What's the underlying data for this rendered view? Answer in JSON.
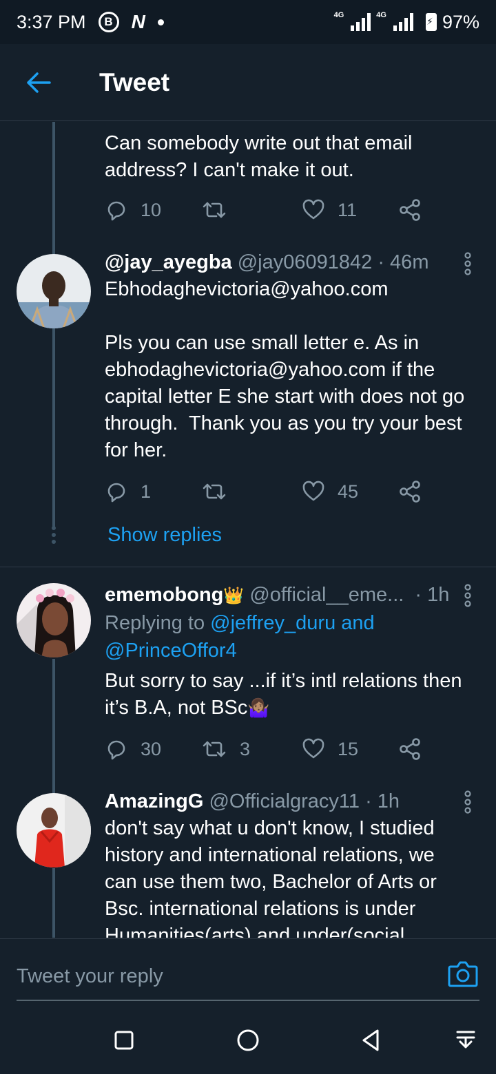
{
  "status_bar": {
    "time": "3:37 PM",
    "battery": "97%",
    "network_1": "4G",
    "network_2": "4G"
  },
  "app_bar": {
    "title": "Tweet"
  },
  "tweets": [
    {
      "text": "Can somebody write out that email address? I can't make it out.",
      "replies": "10",
      "retweets": "",
      "likes": "11"
    },
    {
      "name": "@jay_ayegba",
      "handle": "@jay06091842",
      "time": "· 46m",
      "text": "Ebhodaghevictoria@yahoo.com\n\nPls you can use small letter e. As in ebhodaghevictoria@yahoo.com if the capital letter E she start with does not go through.  Thank you as you try your best for her.",
      "replies": "1",
      "retweets": "",
      "likes": "45",
      "show_replies": "Show replies"
    },
    {
      "name": "ememobong",
      "name_emoji": "👑",
      "handle": "@official__eme...",
      "time": "· 1h",
      "replying_prefix": "Replying to ",
      "replying_users": "@jeffrey_duru and @PrinceOffor4",
      "text": "But sorry to say ...if it’s intl relations then it’s B.A, not BSc",
      "text_emoji": "🤷🏽‍♀️",
      "replies": "30",
      "retweets": "3",
      "likes": "15"
    },
    {
      "name": "AmazingG",
      "handle": "@Officialgracy11",
      "time": "· 1h",
      "text": "don't say what u don't know, I studied history and international relations, we can use them two, Bachelor of Arts or Bsc. international relations is under Humanities(arts) and under(social"
    }
  ],
  "reply_bar": {
    "placeholder": "Tweet your reply"
  },
  "colors": {
    "background": "#15202b",
    "accent": "#1da1f2",
    "secondary_text": "#8899a6",
    "divider": "#2f3b47"
  }
}
